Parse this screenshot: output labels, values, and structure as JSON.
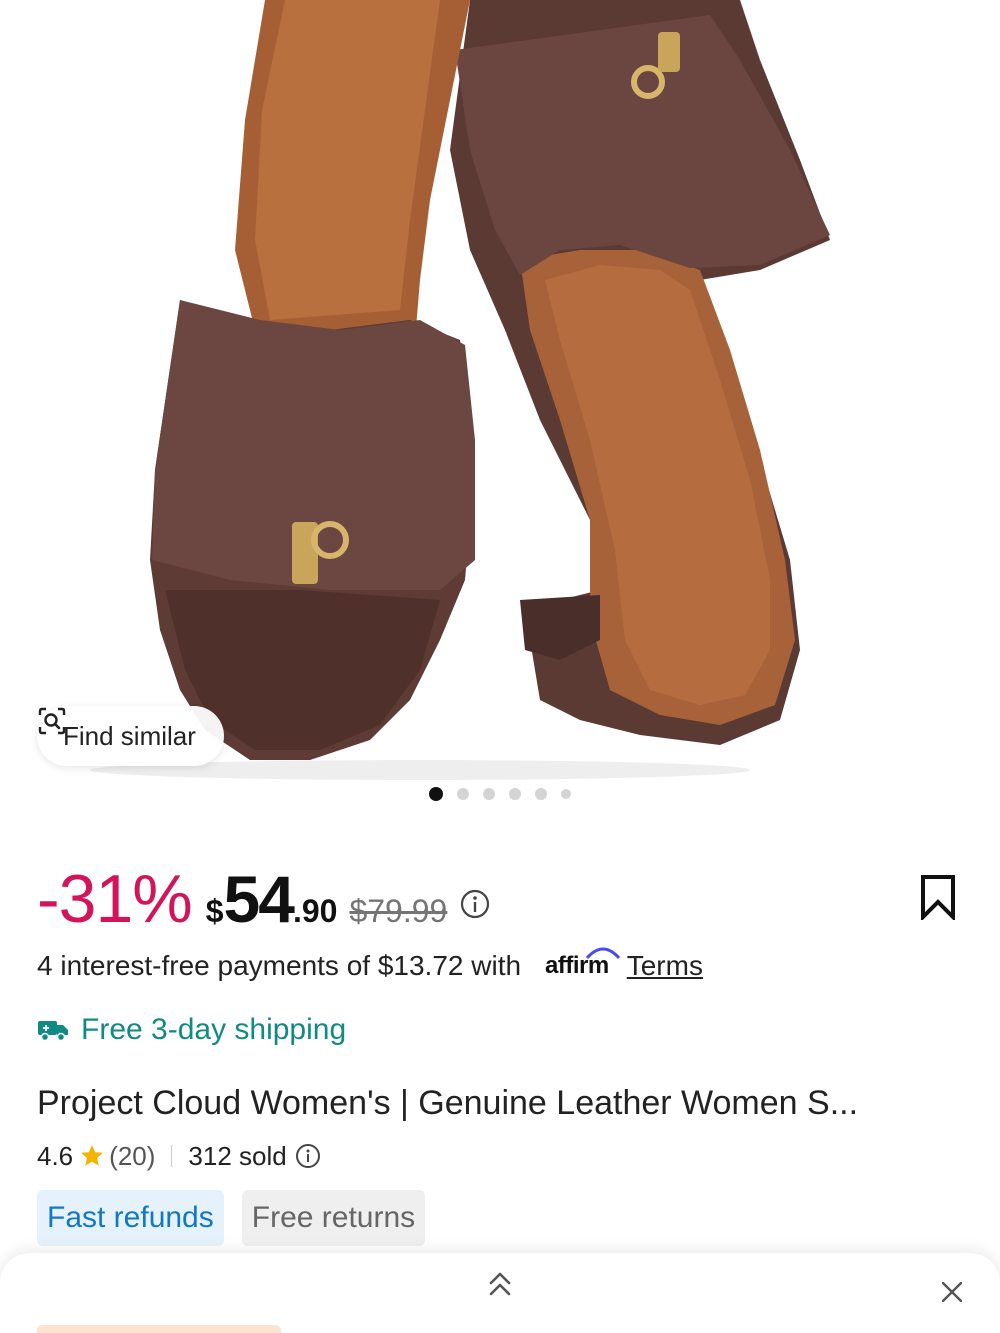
{
  "product_image": {
    "alt_icon": "product-photo",
    "find_similar_label": "Find similar"
  },
  "carousel": {
    "total": 6,
    "active_index": 0
  },
  "price": {
    "discount": "-31%",
    "currency": "$",
    "whole": "54",
    "cents": ".90",
    "original": "$79.99"
  },
  "payments": {
    "text": "4 interest-free payments of $13.72 with",
    "provider": "affirm",
    "terms_label": "Terms"
  },
  "shipping": {
    "label": "Free 3-day shipping",
    "color": "#118a83"
  },
  "product": {
    "title": "Project Cloud Women's | Genuine Leather Women S...",
    "rating": "4.6",
    "reviews": "(20)",
    "sold": "312 sold"
  },
  "badges": {
    "fast_refunds": "Fast refunds",
    "free_returns": "Free returns"
  },
  "colors": {
    "discount": "#d4145a",
    "accent_blue": "#1377c4",
    "star": "#f5b400"
  }
}
